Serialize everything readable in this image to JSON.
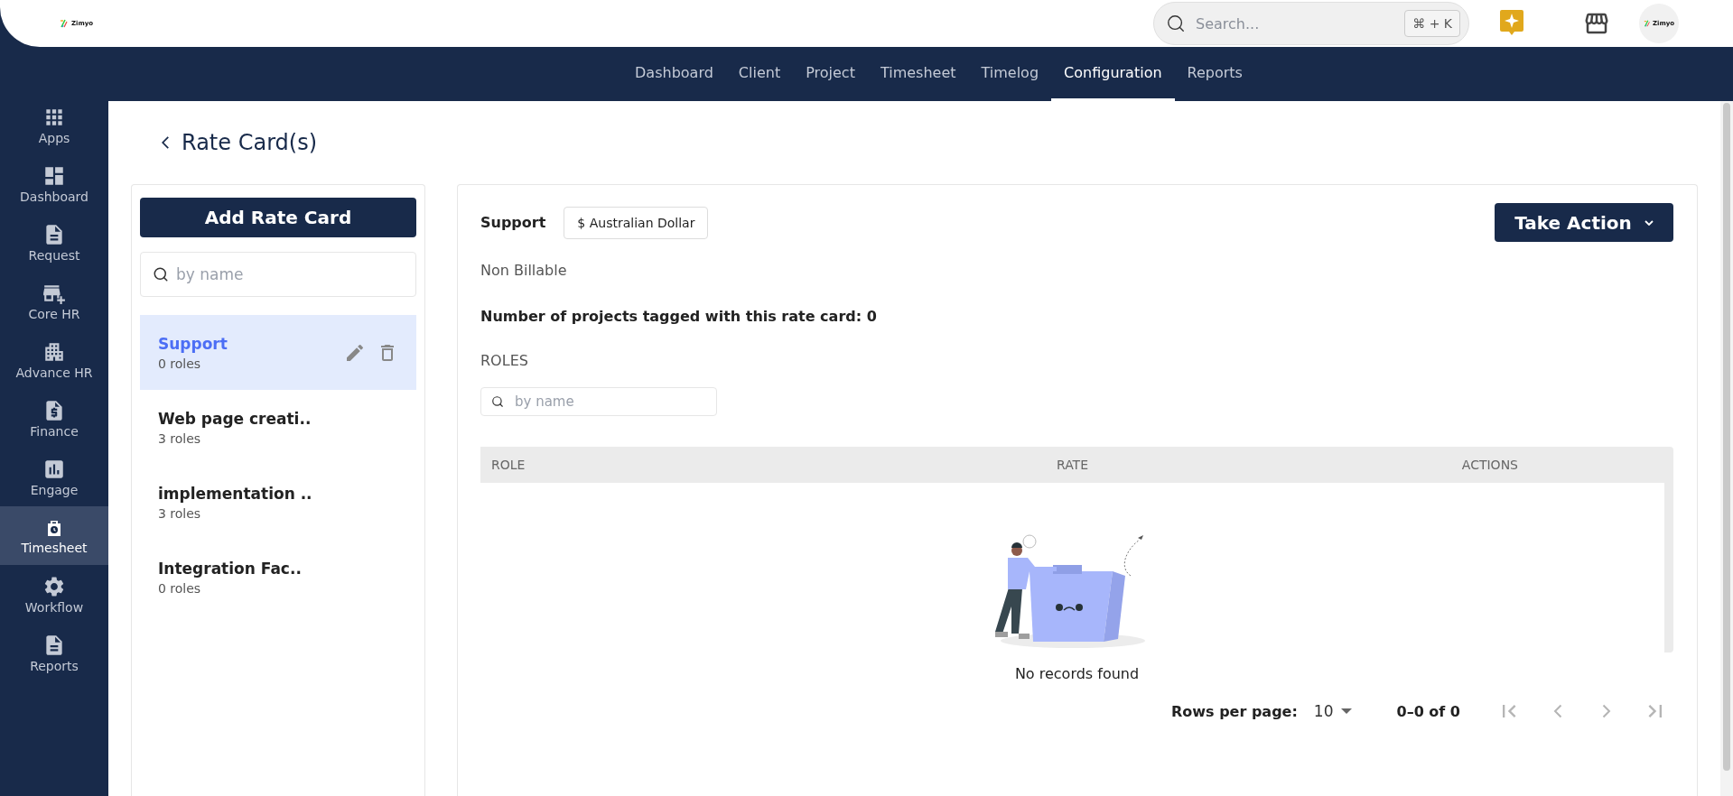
{
  "header": {
    "logo_text": "Zimyo",
    "search": {
      "placeholder": "Search...",
      "shortcut": "⌘ + K"
    },
    "avatar_text": "Zimyo"
  },
  "nav_tabs": [
    {
      "label": "Dashboard",
      "selected": false
    },
    {
      "label": "Client",
      "selected": false
    },
    {
      "label": "Project",
      "selected": false
    },
    {
      "label": "Timesheet",
      "selected": false
    },
    {
      "label": "Timelog",
      "selected": false
    },
    {
      "label": "Configuration",
      "selected": true
    },
    {
      "label": "Reports",
      "selected": false
    }
  ],
  "sidebar": {
    "items": [
      {
        "label": "Apps",
        "selected": false
      },
      {
        "label": "Dashboard",
        "selected": false
      },
      {
        "label": "Request",
        "selected": false
      },
      {
        "label": "Core HR",
        "selected": false
      },
      {
        "label": "Advance HR",
        "selected": false
      },
      {
        "label": "Finance",
        "selected": false
      },
      {
        "label": "Engage",
        "selected": false
      },
      {
        "label": "Timesheet",
        "selected": true
      },
      {
        "label": "Workflow",
        "selected": false
      },
      {
        "label": "Reports",
        "selected": false
      }
    ]
  },
  "page_title": "Rate Card(s)",
  "rate_cards": {
    "add_button": "Add Rate Card",
    "search": {
      "placeholder": "by name"
    },
    "items": [
      {
        "name": "Support",
        "roles": "0 roles",
        "selected": true
      },
      {
        "name": "Web page creati..",
        "roles": "3 roles",
        "selected": false
      },
      {
        "name": "implementation ..",
        "roles": "3 roles",
        "selected": false
      },
      {
        "name": "Integration Fac..",
        "roles": "0 roles",
        "selected": false
      }
    ]
  },
  "detail": {
    "name": "Support",
    "currency": "$ Australian Dollar",
    "action_button": "Take Action",
    "billing": "Non Billable",
    "projects_tagged": "Number of projects tagged with this rate card: 0",
    "roles_heading": "ROLES",
    "roles_search": {
      "placeholder": "by name"
    },
    "table": {
      "columns": [
        "ROLE",
        "RATE",
        "ACTIONS"
      ],
      "empty_text": "No records found"
    },
    "pagination": {
      "rows_per_page_label": "Rows per page:",
      "rows_per_page": "10",
      "range": "0–0 of 0",
      "disabled": true
    }
  }
}
